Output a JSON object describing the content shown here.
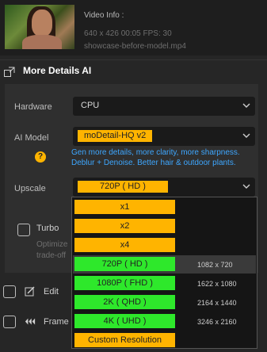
{
  "video_info": {
    "title": "Video Info :",
    "meta": "640 x 426  00:05   FPS: 30",
    "file": "showcase-before-model.mp4"
  },
  "section": {
    "title": "More Details AI",
    "icon": "expand-icon"
  },
  "hardware": {
    "label": "Hardware",
    "value": "CPU"
  },
  "ai_model": {
    "label": "AI Model",
    "value": "moDetail-HQ  v2",
    "description_line1": "Gen more details, more clarity, more sharpness.",
    "description_line2": "Deblur + Denoise. Better hair & outdoor plants.",
    "help": "?"
  },
  "upscale": {
    "label": "Upscale",
    "value": "720P ( HD )",
    "options": [
      {
        "label": "x1",
        "color": "#ffb400",
        "res": ""
      },
      {
        "label": "x2",
        "color": "#ffb400",
        "res": ""
      },
      {
        "label": "x4",
        "color": "#ffb400",
        "res": ""
      },
      {
        "label": "720P ( HD )",
        "color": "#2ee82b",
        "res": "1082 x 720"
      },
      {
        "label": "1080P ( FHD )",
        "color": "#2ee82b",
        "res": "1622 x 1080"
      },
      {
        "label": "2K ( QHD )",
        "color": "#2ee82b",
        "res": "2164 x 1440"
      },
      {
        "label": "4K ( UHD )",
        "color": "#2ee82b",
        "res": "3246 x 2160"
      },
      {
        "label": "Custom Resolution",
        "color": "#ffb400",
        "res": ""
      }
    ]
  },
  "turbo": {
    "label": "Turbo",
    "desc_line1": "Optimize",
    "desc_line2": "trade-off"
  },
  "edit": {
    "label": "Edit"
  },
  "frame": {
    "label": "Frame I"
  }
}
